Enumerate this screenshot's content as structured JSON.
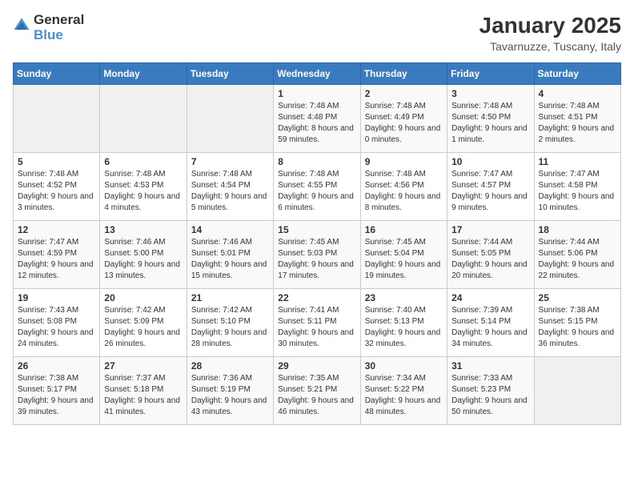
{
  "header": {
    "logo_general": "General",
    "logo_blue": "Blue",
    "month_year": "January 2025",
    "location": "Tavarnuzze, Tuscany, Italy"
  },
  "weekdays": [
    "Sunday",
    "Monday",
    "Tuesday",
    "Wednesday",
    "Thursday",
    "Friday",
    "Saturday"
  ],
  "weeks": [
    [
      {
        "day": "",
        "sunrise": "",
        "sunset": "",
        "daylight": ""
      },
      {
        "day": "",
        "sunrise": "",
        "sunset": "",
        "daylight": ""
      },
      {
        "day": "",
        "sunrise": "",
        "sunset": "",
        "daylight": ""
      },
      {
        "day": "1",
        "sunrise": "Sunrise: 7:48 AM",
        "sunset": "Sunset: 4:48 PM",
        "daylight": "Daylight: 8 hours and 59 minutes."
      },
      {
        "day": "2",
        "sunrise": "Sunrise: 7:48 AM",
        "sunset": "Sunset: 4:49 PM",
        "daylight": "Daylight: 9 hours and 0 minutes."
      },
      {
        "day": "3",
        "sunrise": "Sunrise: 7:48 AM",
        "sunset": "Sunset: 4:50 PM",
        "daylight": "Daylight: 9 hours and 1 minute."
      },
      {
        "day": "4",
        "sunrise": "Sunrise: 7:48 AM",
        "sunset": "Sunset: 4:51 PM",
        "daylight": "Daylight: 9 hours and 2 minutes."
      }
    ],
    [
      {
        "day": "5",
        "sunrise": "Sunrise: 7:48 AM",
        "sunset": "Sunset: 4:52 PM",
        "daylight": "Daylight: 9 hours and 3 minutes."
      },
      {
        "day": "6",
        "sunrise": "Sunrise: 7:48 AM",
        "sunset": "Sunset: 4:53 PM",
        "daylight": "Daylight: 9 hours and 4 minutes."
      },
      {
        "day": "7",
        "sunrise": "Sunrise: 7:48 AM",
        "sunset": "Sunset: 4:54 PM",
        "daylight": "Daylight: 9 hours and 5 minutes."
      },
      {
        "day": "8",
        "sunrise": "Sunrise: 7:48 AM",
        "sunset": "Sunset: 4:55 PM",
        "daylight": "Daylight: 9 hours and 6 minutes."
      },
      {
        "day": "9",
        "sunrise": "Sunrise: 7:48 AM",
        "sunset": "Sunset: 4:56 PM",
        "daylight": "Daylight: 9 hours and 8 minutes."
      },
      {
        "day": "10",
        "sunrise": "Sunrise: 7:47 AM",
        "sunset": "Sunset: 4:57 PM",
        "daylight": "Daylight: 9 hours and 9 minutes."
      },
      {
        "day": "11",
        "sunrise": "Sunrise: 7:47 AM",
        "sunset": "Sunset: 4:58 PM",
        "daylight": "Daylight: 9 hours and 10 minutes."
      }
    ],
    [
      {
        "day": "12",
        "sunrise": "Sunrise: 7:47 AM",
        "sunset": "Sunset: 4:59 PM",
        "daylight": "Daylight: 9 hours and 12 minutes."
      },
      {
        "day": "13",
        "sunrise": "Sunrise: 7:46 AM",
        "sunset": "Sunset: 5:00 PM",
        "daylight": "Daylight: 9 hours and 13 minutes."
      },
      {
        "day": "14",
        "sunrise": "Sunrise: 7:46 AM",
        "sunset": "Sunset: 5:01 PM",
        "daylight": "Daylight: 9 hours and 15 minutes."
      },
      {
        "day": "15",
        "sunrise": "Sunrise: 7:45 AM",
        "sunset": "Sunset: 5:03 PM",
        "daylight": "Daylight: 9 hours and 17 minutes."
      },
      {
        "day": "16",
        "sunrise": "Sunrise: 7:45 AM",
        "sunset": "Sunset: 5:04 PM",
        "daylight": "Daylight: 9 hours and 19 minutes."
      },
      {
        "day": "17",
        "sunrise": "Sunrise: 7:44 AM",
        "sunset": "Sunset: 5:05 PM",
        "daylight": "Daylight: 9 hours and 20 minutes."
      },
      {
        "day": "18",
        "sunrise": "Sunrise: 7:44 AM",
        "sunset": "Sunset: 5:06 PM",
        "daylight": "Daylight: 9 hours and 22 minutes."
      }
    ],
    [
      {
        "day": "19",
        "sunrise": "Sunrise: 7:43 AM",
        "sunset": "Sunset: 5:08 PM",
        "daylight": "Daylight: 9 hours and 24 minutes."
      },
      {
        "day": "20",
        "sunrise": "Sunrise: 7:42 AM",
        "sunset": "Sunset: 5:09 PM",
        "daylight": "Daylight: 9 hours and 26 minutes."
      },
      {
        "day": "21",
        "sunrise": "Sunrise: 7:42 AM",
        "sunset": "Sunset: 5:10 PM",
        "daylight": "Daylight: 9 hours and 28 minutes."
      },
      {
        "day": "22",
        "sunrise": "Sunrise: 7:41 AM",
        "sunset": "Sunset: 5:11 PM",
        "daylight": "Daylight: 9 hours and 30 minutes."
      },
      {
        "day": "23",
        "sunrise": "Sunrise: 7:40 AM",
        "sunset": "Sunset: 5:13 PM",
        "daylight": "Daylight: 9 hours and 32 minutes."
      },
      {
        "day": "24",
        "sunrise": "Sunrise: 7:39 AM",
        "sunset": "Sunset: 5:14 PM",
        "daylight": "Daylight: 9 hours and 34 minutes."
      },
      {
        "day": "25",
        "sunrise": "Sunrise: 7:38 AM",
        "sunset": "Sunset: 5:15 PM",
        "daylight": "Daylight: 9 hours and 36 minutes."
      }
    ],
    [
      {
        "day": "26",
        "sunrise": "Sunrise: 7:38 AM",
        "sunset": "Sunset: 5:17 PM",
        "daylight": "Daylight: 9 hours and 39 minutes."
      },
      {
        "day": "27",
        "sunrise": "Sunrise: 7:37 AM",
        "sunset": "Sunset: 5:18 PM",
        "daylight": "Daylight: 9 hours and 41 minutes."
      },
      {
        "day": "28",
        "sunrise": "Sunrise: 7:36 AM",
        "sunset": "Sunset: 5:19 PM",
        "daylight": "Daylight: 9 hours and 43 minutes."
      },
      {
        "day": "29",
        "sunrise": "Sunrise: 7:35 AM",
        "sunset": "Sunset: 5:21 PM",
        "daylight": "Daylight: 9 hours and 46 minutes."
      },
      {
        "day": "30",
        "sunrise": "Sunrise: 7:34 AM",
        "sunset": "Sunset: 5:22 PM",
        "daylight": "Daylight: 9 hours and 48 minutes."
      },
      {
        "day": "31",
        "sunrise": "Sunrise: 7:33 AM",
        "sunset": "Sunset: 5:23 PM",
        "daylight": "Daylight: 9 hours and 50 minutes."
      },
      {
        "day": "",
        "sunrise": "",
        "sunset": "",
        "daylight": ""
      }
    ]
  ]
}
